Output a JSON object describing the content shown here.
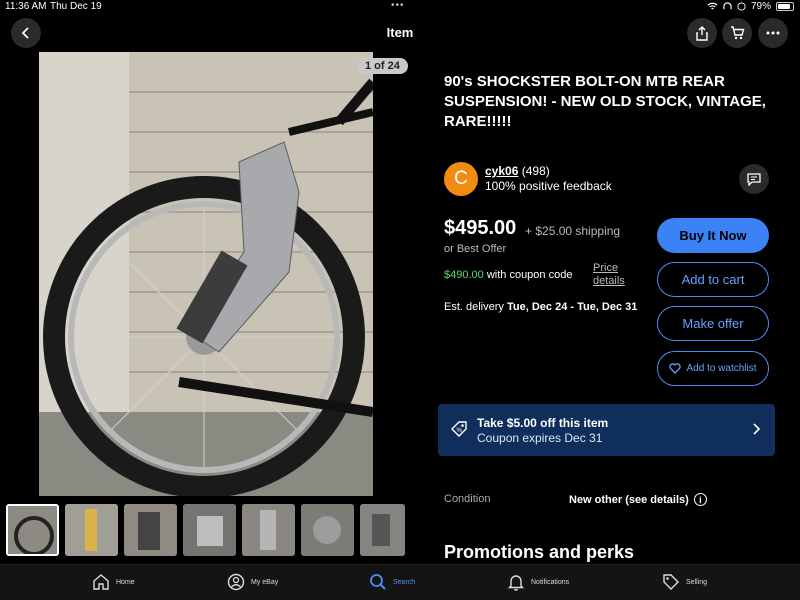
{
  "status_bar": {
    "time": "11:36 AM",
    "date": "Thu Dec 19",
    "battery": "79%"
  },
  "header": {
    "title": "Item"
  },
  "gallery": {
    "counter": "1 of 24",
    "thumb_count": 7
  },
  "listing": {
    "title": "90's SHOCKSTER BOLT-ON MTB REAR SUSPENSION! - NEW OLD STOCK, VINTAGE, RARE!!!!!",
    "seller": {
      "avatar_letter": "C",
      "name": "cyk06",
      "rating": "(498)",
      "feedback": "100% positive feedback"
    },
    "price": "$495.00",
    "shipping": "+ $25.00 shipping",
    "best_offer": "or Best Offer",
    "coupon_price": "$490.00",
    "coupon_text": "with coupon code",
    "price_details": "Price details",
    "delivery_label": "Est. delivery",
    "delivery_range": "Tue, Dec 24 - Tue, Dec 31"
  },
  "actions": {
    "buy_now": "Buy It Now",
    "add_to_cart": "Add to cart",
    "make_offer": "Make offer",
    "watchlist": "Add to watchlist"
  },
  "coupon_banner": {
    "title": "Take $5.00 off this item",
    "subtitle": "Coupon expires Dec 31"
  },
  "condition": {
    "label": "Condition",
    "value": "New other (see details)"
  },
  "promotions": {
    "heading": "Promotions and perks"
  },
  "tabbar": {
    "items": [
      {
        "label": "Home",
        "icon": "home-icon"
      },
      {
        "label": "My eBay",
        "icon": "person-icon"
      },
      {
        "label": "Search",
        "icon": "search-icon",
        "active": true
      },
      {
        "label": "Notifications",
        "icon": "bell-icon"
      },
      {
        "label": "Selling",
        "icon": "tag-icon"
      }
    ]
  },
  "colors": {
    "accent": "#3b82f6",
    "avatar": "#f08c12",
    "coupon_green": "#5bd96b",
    "banner": "#0f2e5c"
  }
}
